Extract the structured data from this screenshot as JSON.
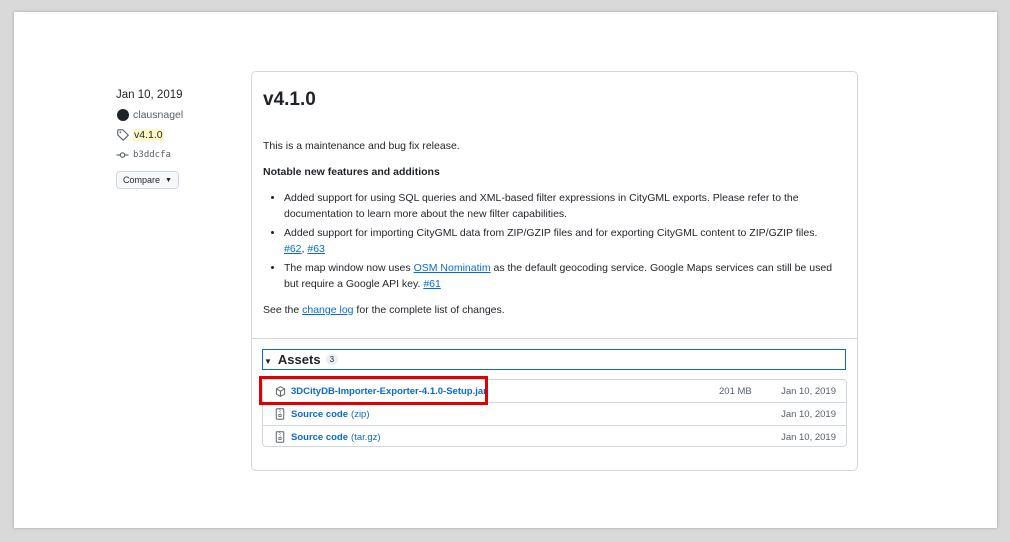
{
  "meta": {
    "date": "Jan 10, 2019",
    "user": "clausnagel",
    "tag": "v4.1.0",
    "commit": "b3ddcfa",
    "compare_label": "Compare"
  },
  "release": {
    "title": "v4.1.0",
    "intro": "This is a maintenance and bug fix release.",
    "notable_heading": "Notable new features and additions",
    "bullets": [
      {
        "text": "Added support for using SQL queries and XML-based filter expressions in CityGML exports. Please refer to the documentation to learn more about the new filter capabilities."
      },
      {
        "text": "Added support for importing CityGML data from ZIP/GZIP files and for exporting CityGML content to ZIP/GZIP files.",
        "link1": "#62",
        "sep": ", ",
        "link2": "#63"
      },
      {
        "pre": "The map window now uses ",
        "link_osm": "OSM Nominatim",
        "post": " as the default geocoding service. Google Maps services can still be used but require a Google API key. ",
        "link3": "#61"
      }
    ],
    "see_pre": "See the ",
    "see_link": "change log",
    "see_post": " for the complete list of changes."
  },
  "assets": {
    "label": "Assets",
    "count": "3",
    "items": [
      {
        "name": "3DCityDB-Importer-Exporter-4.1.0-Setup.jar",
        "ext": "",
        "size": "201 MB",
        "date": "Jan 10, 2019",
        "icon": "package-icon"
      },
      {
        "name": "Source code",
        "ext": "(zip)",
        "size": "",
        "date": "Jan 10, 2019",
        "icon": "file-zip-icon"
      },
      {
        "name": "Source code",
        "ext": "(tar.gz)",
        "size": "",
        "date": "Jan 10, 2019",
        "icon": "file-zip-icon"
      }
    ]
  },
  "colors": {
    "link": "#0969da",
    "highlight": "#e00000",
    "tag_bg": "#fff8c5"
  }
}
